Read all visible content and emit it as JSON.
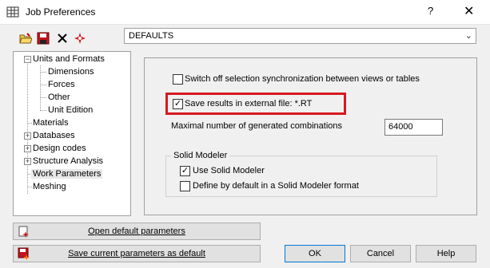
{
  "window": {
    "title": "Job Preferences",
    "help_label": "?",
    "close_label": "✕"
  },
  "toolbar": {
    "combo_value": "DEFAULTS"
  },
  "tree": {
    "items": [
      {
        "label": "Units and Formats",
        "level": 0,
        "expander": "−"
      },
      {
        "label": "Dimensions",
        "level": 1
      },
      {
        "label": "Forces",
        "level": 1
      },
      {
        "label": "Other",
        "level": 1
      },
      {
        "label": "Unit Edition",
        "level": 1
      },
      {
        "label": "Materials",
        "level": 0
      },
      {
        "label": "Databases",
        "level": 0,
        "expander": "+"
      },
      {
        "label": "Design codes",
        "level": 0,
        "expander": "+"
      },
      {
        "label": "Structure Analysis",
        "level": 0,
        "expander": "+"
      },
      {
        "label": "Work Parameters",
        "level": 0,
        "selected": true
      },
      {
        "label": "Meshing",
        "level": 0
      }
    ]
  },
  "panel": {
    "switch_off_sync": {
      "label": "Switch off selection synchronization between views or tables",
      "checked": false
    },
    "save_results": {
      "label": "Save results in external file: *.RT",
      "checked": true
    },
    "max_combinations": {
      "label": "Maximal number of generated combinations",
      "value": "64000"
    },
    "solid_modeler": {
      "group_label": "Solid Modeler",
      "use": {
        "label": "Use Solid Modeler",
        "checked": true
      },
      "define_default": {
        "label": "Define by default in a Solid Modeler format",
        "checked": false
      }
    }
  },
  "buttons": {
    "open_default": "Open default parameters",
    "save_default": "Save current parameters as default",
    "ok": "OK",
    "cancel": "Cancel",
    "help": "Help"
  },
  "colors": {
    "highlight": "#d71920"
  }
}
